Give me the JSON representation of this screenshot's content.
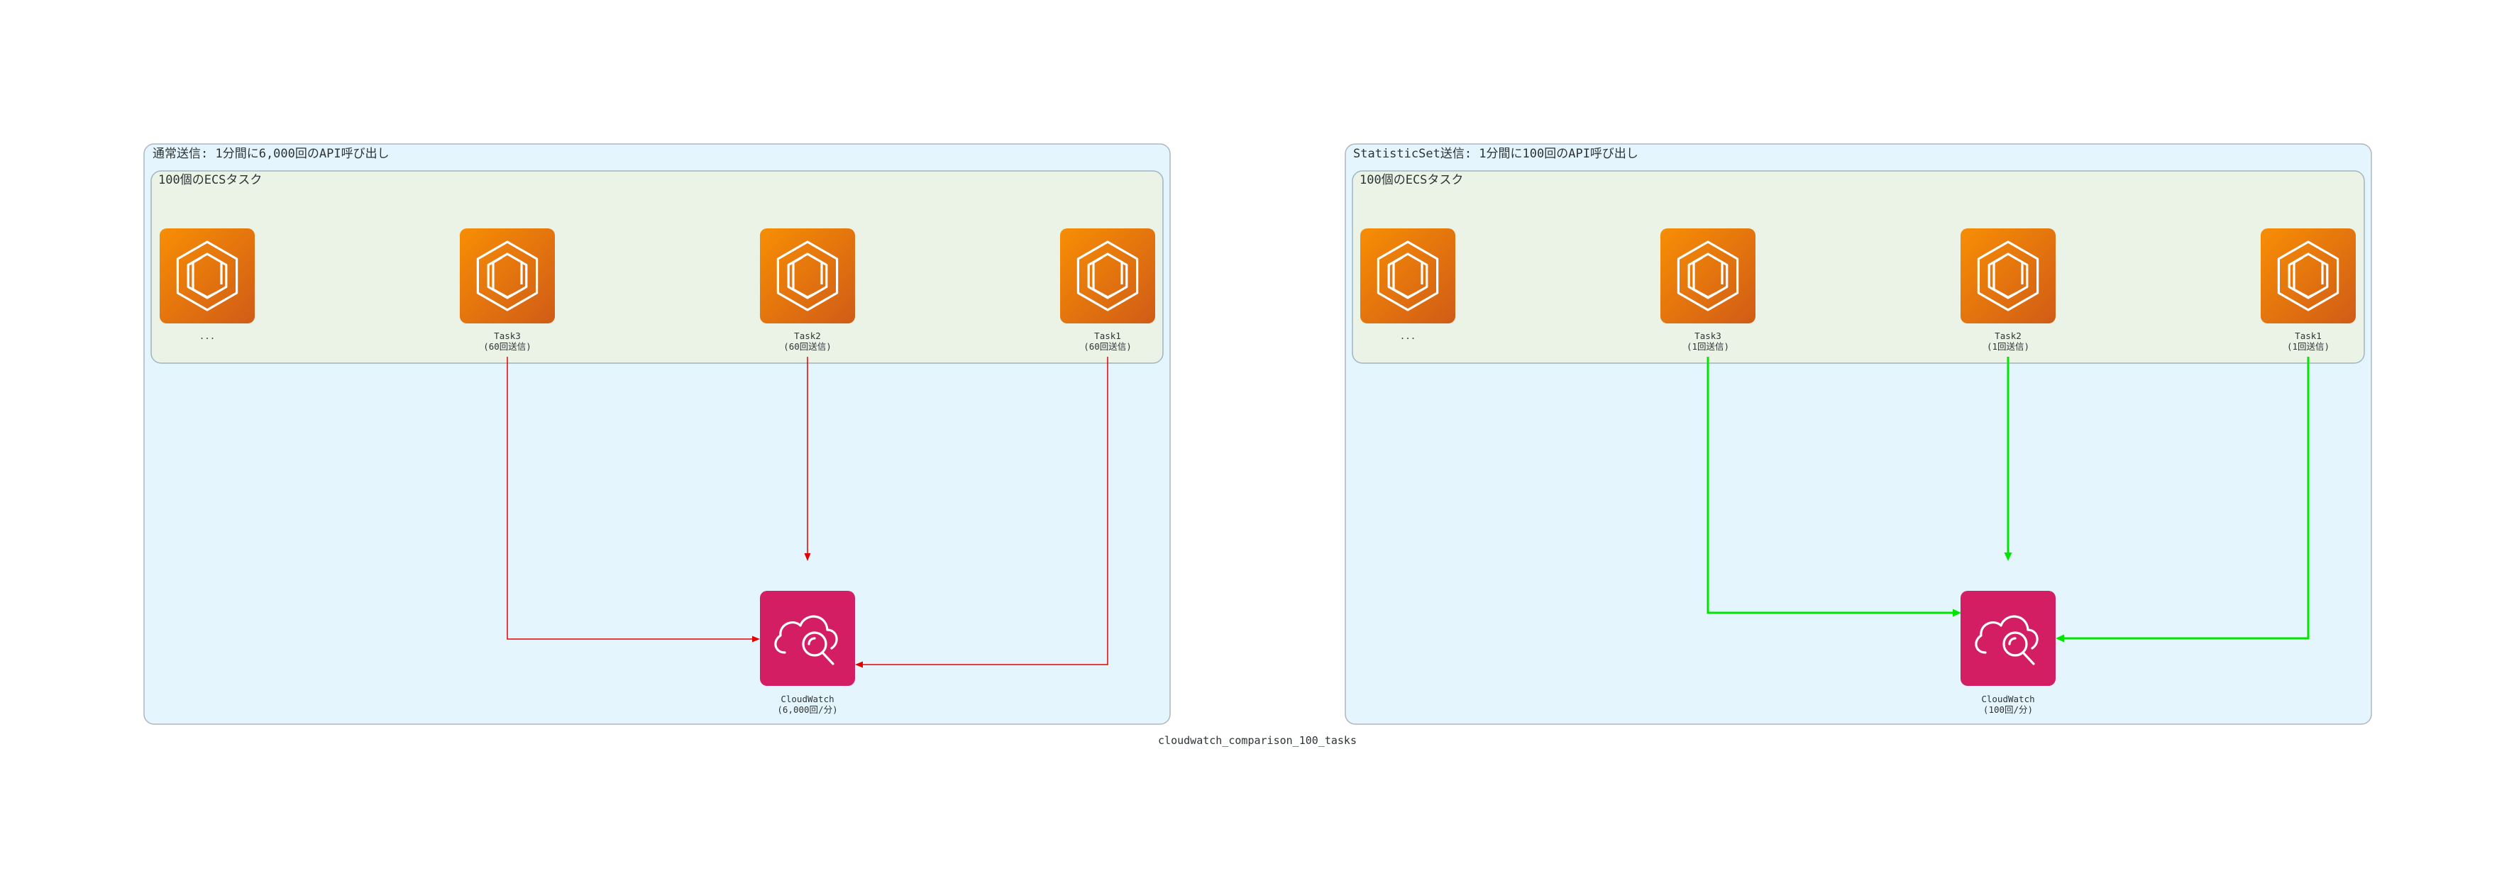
{
  "diagram": {
    "title": "cloudwatch_comparison_100_tasks",
    "colors": {
      "outer_fill": "#e5f5fd",
      "outer_border": "#aeb6be",
      "inner_fill": "#ebf3e7",
      "inner_border": "#9fb5c2",
      "ecs_top": "#f78e04",
      "ecs_bottom": "#d05c17",
      "cloudwatch_fill": "#d41e63",
      "edge_normal": "#e60000",
      "edge_statistic": "#00e600"
    },
    "clusters": [
      {
        "label": "通常送信: 1分間に6,000回のAPI呼び出し",
        "inner_label": "100個のECSタスク",
        "tasks": [
          {
            "line1": "...",
            "line2": ""
          },
          {
            "line1": "Task3",
            "line2": "(60回送信)"
          },
          {
            "line1": "Task2",
            "line2": "(60回送信)"
          },
          {
            "line1": "Task1",
            "line2": "(60回送信)"
          }
        ],
        "cloudwatch": {
          "line1": "CloudWatch",
          "line2": "(6,000回/分)"
        }
      },
      {
        "label": "StatisticSet送信: 1分間に100回のAPI呼び出し",
        "inner_label": "100個のECSタスク",
        "tasks": [
          {
            "line1": "...",
            "line2": ""
          },
          {
            "line1": "Task3",
            "line2": "(1回送信)"
          },
          {
            "line1": "Task2",
            "line2": "(1回送信)"
          },
          {
            "line1": "Task1",
            "line2": "(1回送信)"
          }
        ],
        "cloudwatch": {
          "line1": "CloudWatch",
          "line2": "(100回/分)"
        }
      }
    ]
  }
}
